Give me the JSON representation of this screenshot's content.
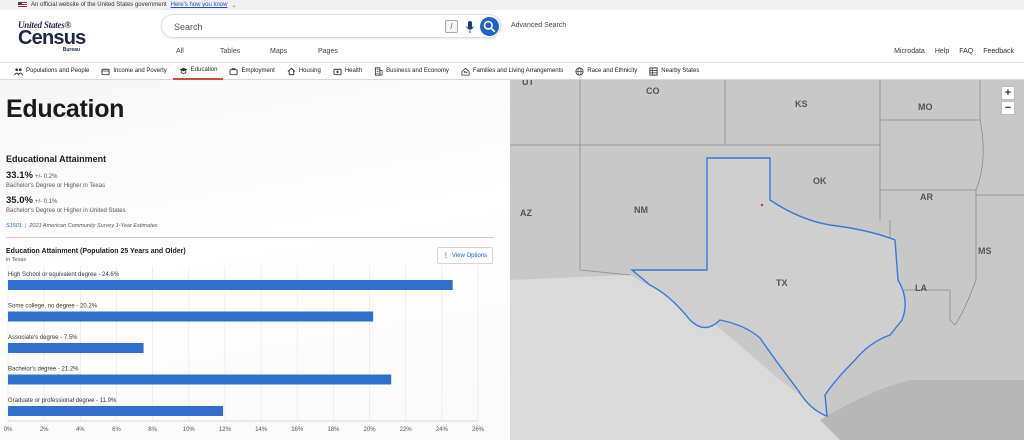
{
  "banner": {
    "text": "An official website of the United States government",
    "link": "Here's how you know"
  },
  "logo": {
    "top": "United States®",
    "mid": "Census",
    "bot": "Bureau"
  },
  "search": {
    "placeholder": "Search",
    "slash": "/",
    "advanced": "Advanced Search"
  },
  "search_tabs": [
    "All",
    "Tables",
    "Maps",
    "Pages"
  ],
  "utility": [
    "Microdata",
    "Help",
    "FAQ",
    "Feedback"
  ],
  "topics": [
    {
      "label": "Populations and People",
      "icon": "people-icon"
    },
    {
      "label": "Income and Poverty",
      "icon": "wallet-icon"
    },
    {
      "label": "Education",
      "icon": "graduation-cap-icon",
      "active": true
    },
    {
      "label": "Employment",
      "icon": "briefcase-icon"
    },
    {
      "label": "Housing",
      "icon": "house-icon"
    },
    {
      "label": "Health",
      "icon": "medical-kit-icon"
    },
    {
      "label": "Business and Economy",
      "icon": "building-icon"
    },
    {
      "label": "Families and Living Arrangements",
      "icon": "family-icon"
    },
    {
      "label": "Race and Ethnicity",
      "icon": "globe-people-icon"
    },
    {
      "label": "Nearby States",
      "icon": "grid-icon"
    }
  ],
  "page": {
    "title": "Education",
    "attainment": {
      "title": "Educational Attainment",
      "stat1": {
        "value": "33.1%",
        "moe": "+/- 0.2%",
        "desc": "Bachelor's Degree or Higher in Texas"
      },
      "stat2": {
        "value": "35.0%",
        "moe": "+/- 0.1%",
        "desc": "Bachelor's Degree or Higher in United States"
      },
      "source_code": "S1501",
      "source_text": "2021 American Community Survey 1-Year Estimates"
    },
    "chart_header": {
      "title": "Education Attainment (Population 25 Years and Older)",
      "subtitle": "in Texas",
      "view_options": "View Options"
    }
  },
  "chart_data": {
    "type": "bar",
    "orientation": "horizontal",
    "categories": [
      "High School or equivalent degree - 24.6%",
      "Some college, no degree - 20.2%",
      "Associate's degree - 7.5%",
      "Bachelor's degree - 21.2%",
      "Graduate or professional degree - 11.9%"
    ],
    "values": [
      24.6,
      20.2,
      7.5,
      21.2,
      11.9
    ],
    "xlim": [
      0,
      26
    ],
    "xticks": [
      "0%",
      "2%",
      "4%",
      "6%",
      "8%",
      "10%",
      "12%",
      "14%",
      "16%",
      "18%",
      "20%",
      "22%",
      "24%",
      "26%"
    ],
    "grid": true,
    "bar_color": "#2f6fce"
  },
  "map": {
    "states": [
      "CO",
      "KS",
      "MO",
      "OK",
      "AR",
      "AZ",
      "NM",
      "TX",
      "LA",
      "MS",
      "UT"
    ],
    "zoom_in": "+",
    "zoom_out": "−",
    "highlight_color": "#3a78d8"
  }
}
